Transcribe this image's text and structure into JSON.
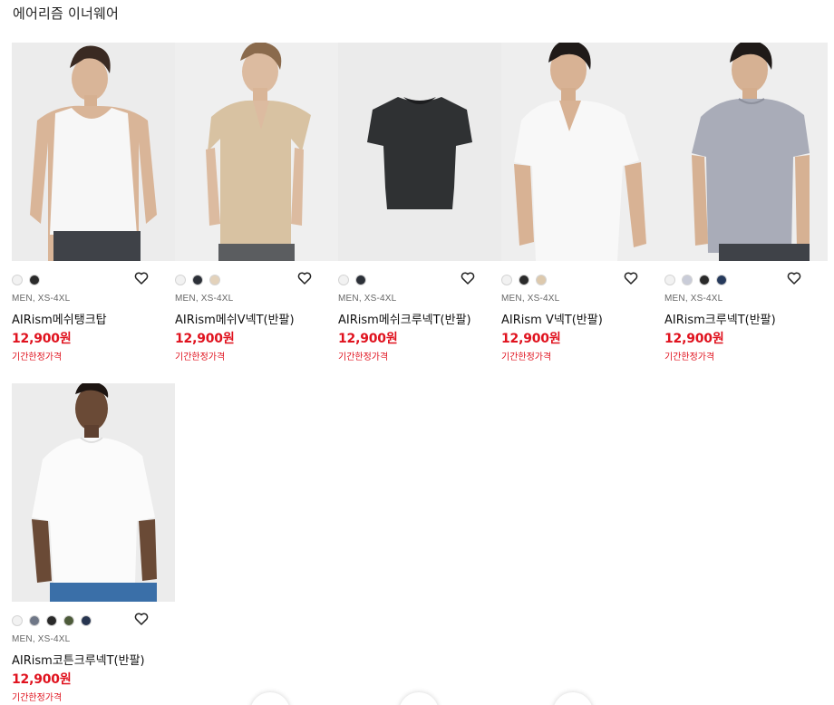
{
  "section": {
    "title": "에어리즘 이너웨어"
  },
  "products": [
    {
      "name": "AIRism메쉬탱크탑",
      "meta": "MEN, XS-4XL",
      "price": "12,900원",
      "price_note": "기간한정가격",
      "photo": "model-tank-top",
      "colors": [
        "#f2f2f2",
        "#2a2a2a"
      ]
    },
    {
      "name": "AIRism메쉬V넥T(반팔)",
      "meta": "MEN, XS-4XL",
      "price": "12,900원",
      "price_note": "기간한정가격",
      "photo": "model-beige-vneck",
      "colors": [
        "#f2f2f2",
        "#2c3038",
        "#e3d2bb"
      ]
    },
    {
      "name": "AIRism메쉬크루넥T(반팔)",
      "meta": "MEN, XS-4XL",
      "price": "12,900원",
      "price_note": "기간한정가격",
      "photo": "flat-black-tee",
      "colors": [
        "#f2f2f2",
        "#2c3038"
      ]
    },
    {
      "name": "AIRism V넥T(반팔)",
      "meta": "MEN, XS-4XL",
      "price": "12,900원",
      "price_note": "기간한정가격",
      "photo": "model-white-vneck",
      "colors": [
        "#f2f2f2",
        "#2a2a2a",
        "#ddc9ad"
      ]
    },
    {
      "name": "AIRism크루넥T(반팔)",
      "meta": "MEN, XS-4XL",
      "price": "12,900원",
      "price_note": "기간한정가격",
      "photo": "model-grey-crew",
      "colors": [
        "#f2f2f2",
        "#c9ccd8",
        "#2a2a2a",
        "#263a5c"
      ]
    },
    {
      "name": "AIRism코튼크루넥T(반팔)",
      "meta": "MEN, XS-4XL",
      "price": "12,900원",
      "price_note": "기간한정가격",
      "photo": "model-white-crew",
      "colors": [
        "#f2f2f2",
        "#6f7787",
        "#2a2a2a",
        "#4d5b3a",
        "#273550"
      ]
    }
  ],
  "icons": {
    "wishlist": "heart-outline-icon"
  }
}
